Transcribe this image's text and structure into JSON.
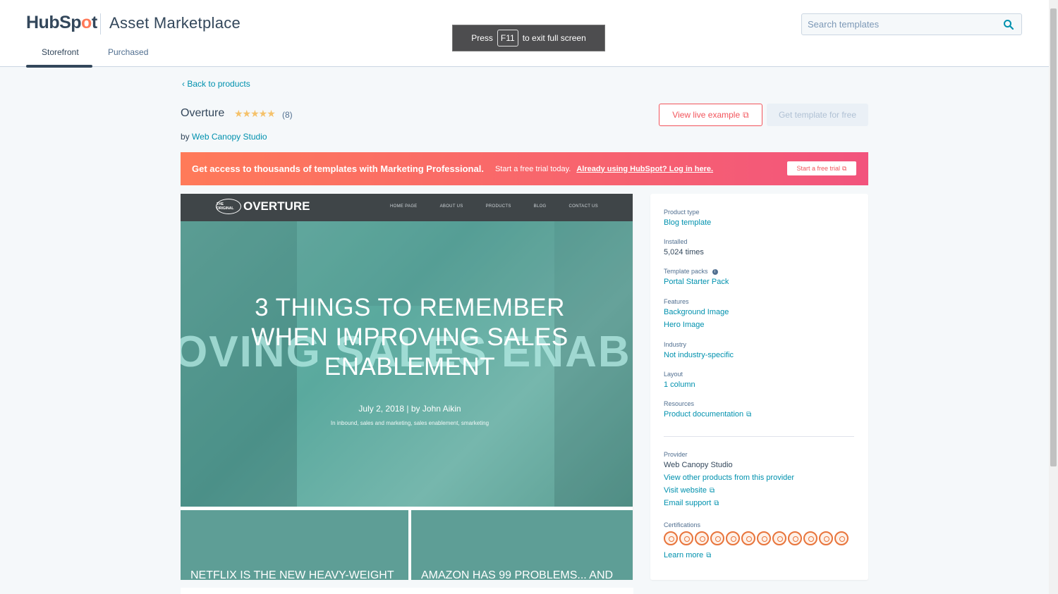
{
  "header": {
    "logo_pre": "HubSp",
    "logo_post": "t",
    "app_title": "Asset Marketplace",
    "tabs": [
      {
        "label": "Storefront",
        "active": true
      },
      {
        "label": "Purchased",
        "active": false
      }
    ],
    "search_placeholder": "Search templates",
    "search_icon": "search-icon"
  },
  "fullscreen_notice": {
    "press": "Press",
    "key": "F11",
    "rest": "to exit full screen"
  },
  "product": {
    "back_label": "Back to products",
    "name": "Overture",
    "stars": "★★★★★",
    "rating_count": "(8)",
    "by": "by",
    "author": "Web Canopy Studio",
    "view_live_label": "View live example",
    "get_template_label": "Get template for free"
  },
  "promo": {
    "headline": "Get access to thousands of templates with Marketing Professional.",
    "trial_text": "Start a free trial today.",
    "login_link": "Already using HubSpot? Log in here.",
    "button_label": "Start a free trial"
  },
  "preview": {
    "brand": "OVERTURE",
    "badge_text": "THE ORIGINAL",
    "nav": [
      "HOME PAGE",
      "ABOUT US",
      "PRODUCTS",
      "BLOG",
      "CONTACT US"
    ],
    "ghost_text": "OVING SALES ENABLI",
    "hero_title": "3 THINGS TO REMEMBER WHEN IMPROVING SALES ENABLEMENT",
    "hero_meta": "July 2, 2018 | by John Aikin",
    "hero_tags": "In inbound, sales and marketing, sales enablement, smarketing",
    "cards": [
      "NETFLIX IS THE NEW HEAVY-WEIGHT",
      "AMAZON HAS 99 PROBLEMS... AND"
    ]
  },
  "sidebar": {
    "product_type": {
      "label": "Product type",
      "value": "Blog template"
    },
    "installed": {
      "label": "Installed",
      "value": "5,024 times"
    },
    "template_packs": {
      "label": "Template packs",
      "value": "Portal Starter Pack",
      "info_icon": "info-icon"
    },
    "features": {
      "label": "Features",
      "values": [
        "Background Image",
        "Hero Image"
      ]
    },
    "industry": {
      "label": "Industry",
      "value": "Not industry-specific"
    },
    "layout": {
      "label": "Layout",
      "value": "1 column"
    },
    "resources": {
      "label": "Resources",
      "value": "Product documentation"
    },
    "provider": {
      "label": "Provider",
      "name": "Web Canopy Studio",
      "other_products": "View other products from this provider",
      "visit_website": "Visit website",
      "email_support": "Email support"
    },
    "certifications": {
      "label": "Certifications",
      "count": 12,
      "learn_more": "Learn more"
    }
  },
  "colors": {
    "accent": "#0091ae",
    "brand_orange": "#ff7a59",
    "promo_end": "#f2547d",
    "text": "#33475b",
    "hero_teal": "#6fb9ad"
  }
}
